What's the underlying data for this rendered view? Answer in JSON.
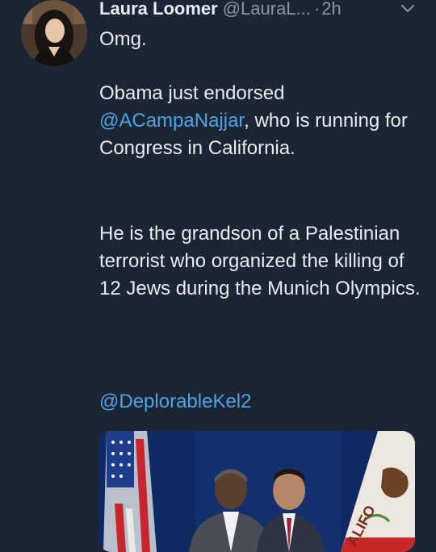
{
  "tweet": {
    "author_name": "Laura Loomer",
    "author_handle": "@LauraL...",
    "separator": "·",
    "time": "2h",
    "menu_icon": "chevron-down-icon",
    "text_line1": "Omg.",
    "paragraph2_pre": "Obama just endorsed ",
    "paragraph2_mention": "@ACampaNajjar",
    "paragraph2_post": ", who is running for Congress in California.",
    "paragraph3": "He is the grandson of a Palestinian terrorist who organized the killing of 12 Jews during the Munich Olympics.",
    "mention_footer": "@DeplorableKel2",
    "media_flag_text": "ALIFO"
  },
  "colors": {
    "background": "#1b2533",
    "text": "#e8ecf0",
    "secondary": "#8899a6",
    "link": "#4fa4e6"
  }
}
